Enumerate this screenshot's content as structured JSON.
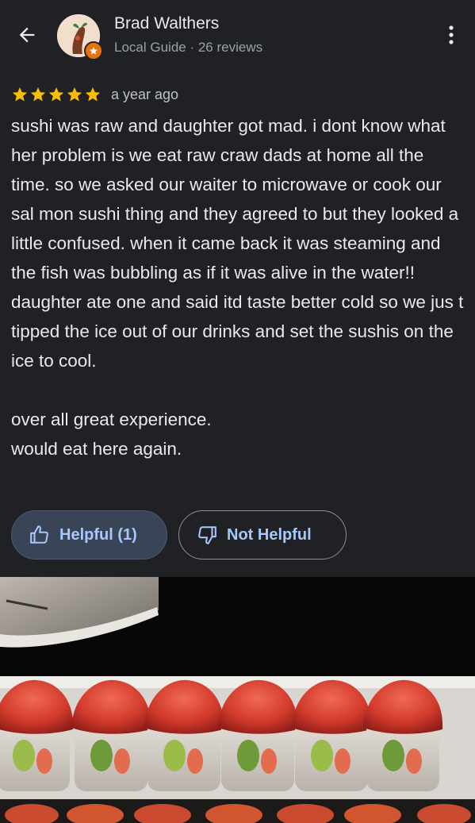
{
  "header": {
    "back_icon": "arrow-left-icon",
    "user_name": "Brad Walthers",
    "user_meta": "Local Guide · 26 reviews",
    "more_icon": "more-vertical-icon",
    "badge_color": "#e8710a"
  },
  "review": {
    "rating": 5,
    "rating_max": 5,
    "star_color": "#fbbc04",
    "date": "a year ago",
    "text": "sushi was raw and daughter got mad. i dont know what her problem is we eat raw craw dads at home all the time. so we asked our waiter to microwave or cook our sal mon sushi thing and they agreed to but they looked a little confused. when it came back it was steaming and the fish was bubbling as if it was alive in the water!! daughter ate one and said itd taste better cold so we jus t tipped the ice out of our drinks and set the sushis on the ice to cool.\n\nover all great experience.\nwould eat here again."
  },
  "actions": {
    "helpful_label": "Helpful (1)",
    "helpful_icon": "thumbs-up-icon",
    "not_helpful_label": "Not Helpful",
    "not_helpful_icon": "thumbs-down-icon",
    "accent_color": "#a8c7fa"
  },
  "photo": {
    "subject": "sushi-rolls-photo"
  }
}
